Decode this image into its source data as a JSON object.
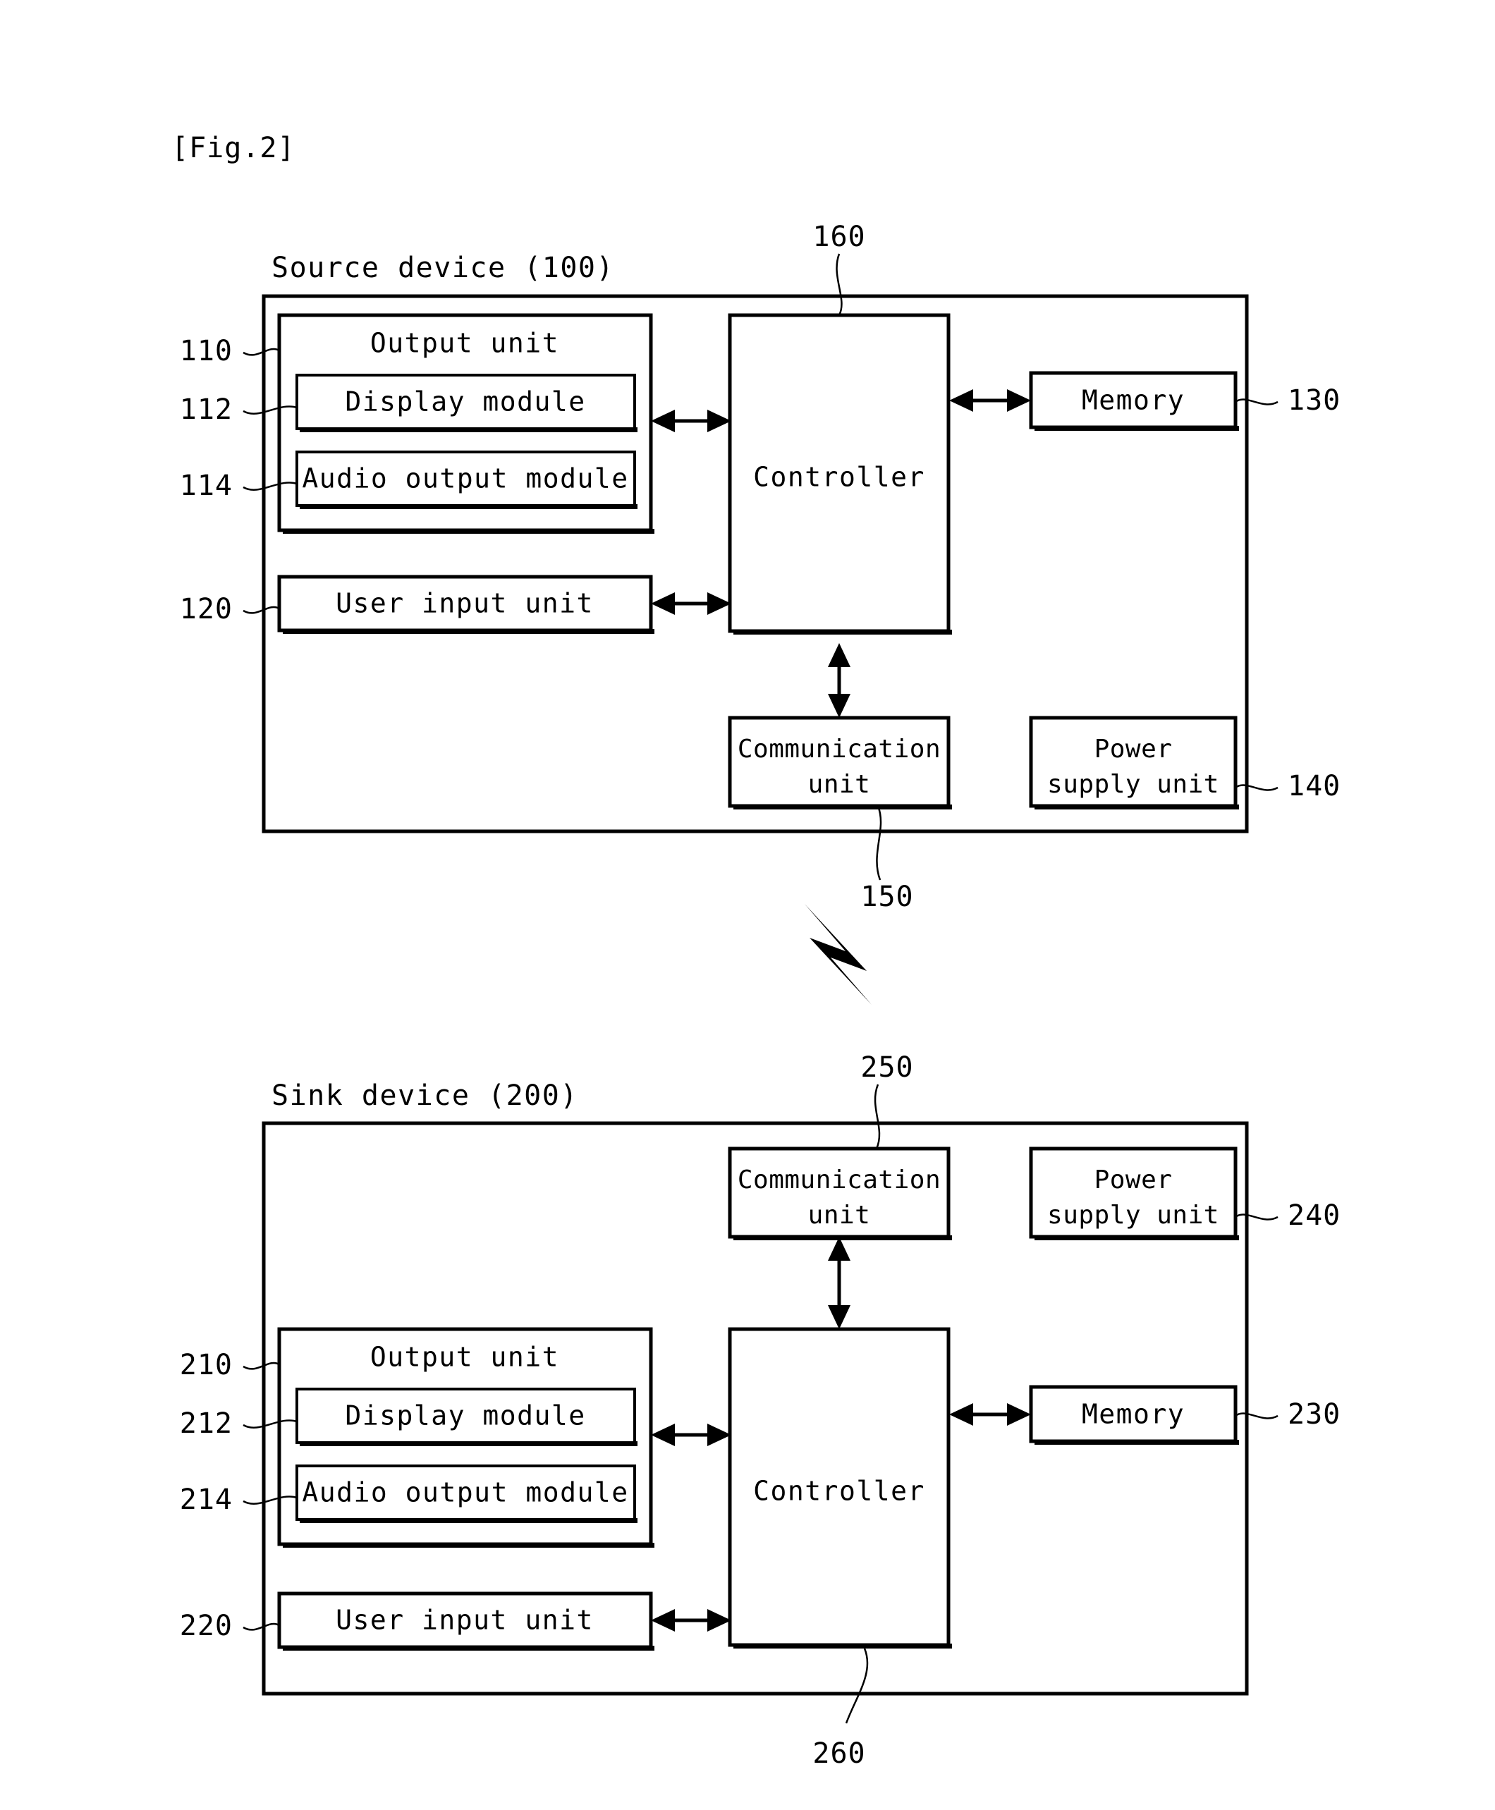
{
  "figure": {
    "caption": "[Fig.2]"
  },
  "source_device": {
    "title": "Source device (100)",
    "ref_outer": "100",
    "output_unit": {
      "label": "Output unit",
      "ref": "110",
      "display_module": {
        "label": "Display module",
        "ref": "112"
      },
      "audio_output_module": {
        "label": "Audio output module",
        "ref": "114"
      }
    },
    "user_input_unit": {
      "label": "User input unit",
      "ref": "120"
    },
    "controller": {
      "label": "Controller",
      "ref": "160"
    },
    "memory": {
      "label": "Memory",
      "ref": "130"
    },
    "communication_unit": {
      "label_line1": "Communication",
      "label_line2": "unit",
      "ref": "150"
    },
    "power_supply_unit": {
      "label_line1": "Power",
      "label_line2": "supply unit",
      "ref": "140"
    }
  },
  "wireless_link": {
    "icon": "lightning-bolt-icon",
    "ref": "150"
  },
  "sink_device": {
    "title": "Sink device (200)",
    "ref_outer": "200",
    "communication_unit": {
      "label_line1": "Communication",
      "label_line2": "unit",
      "ref": "250"
    },
    "power_supply_unit": {
      "label_line1": "Power",
      "label_line2": "supply unit",
      "ref": "240"
    },
    "output_unit": {
      "label": "Output unit",
      "ref": "210",
      "display_module": {
        "label": "Display module",
        "ref": "212"
      },
      "audio_output_module": {
        "label": "Audio output module",
        "ref": "214"
      }
    },
    "user_input_unit": {
      "label": "User input unit",
      "ref": "220"
    },
    "controller": {
      "label": "Controller",
      "ref": "260"
    },
    "memory": {
      "label": "Memory",
      "ref": "230"
    }
  },
  "colors": {
    "ink": "#000000",
    "paper": "#ffffff"
  }
}
